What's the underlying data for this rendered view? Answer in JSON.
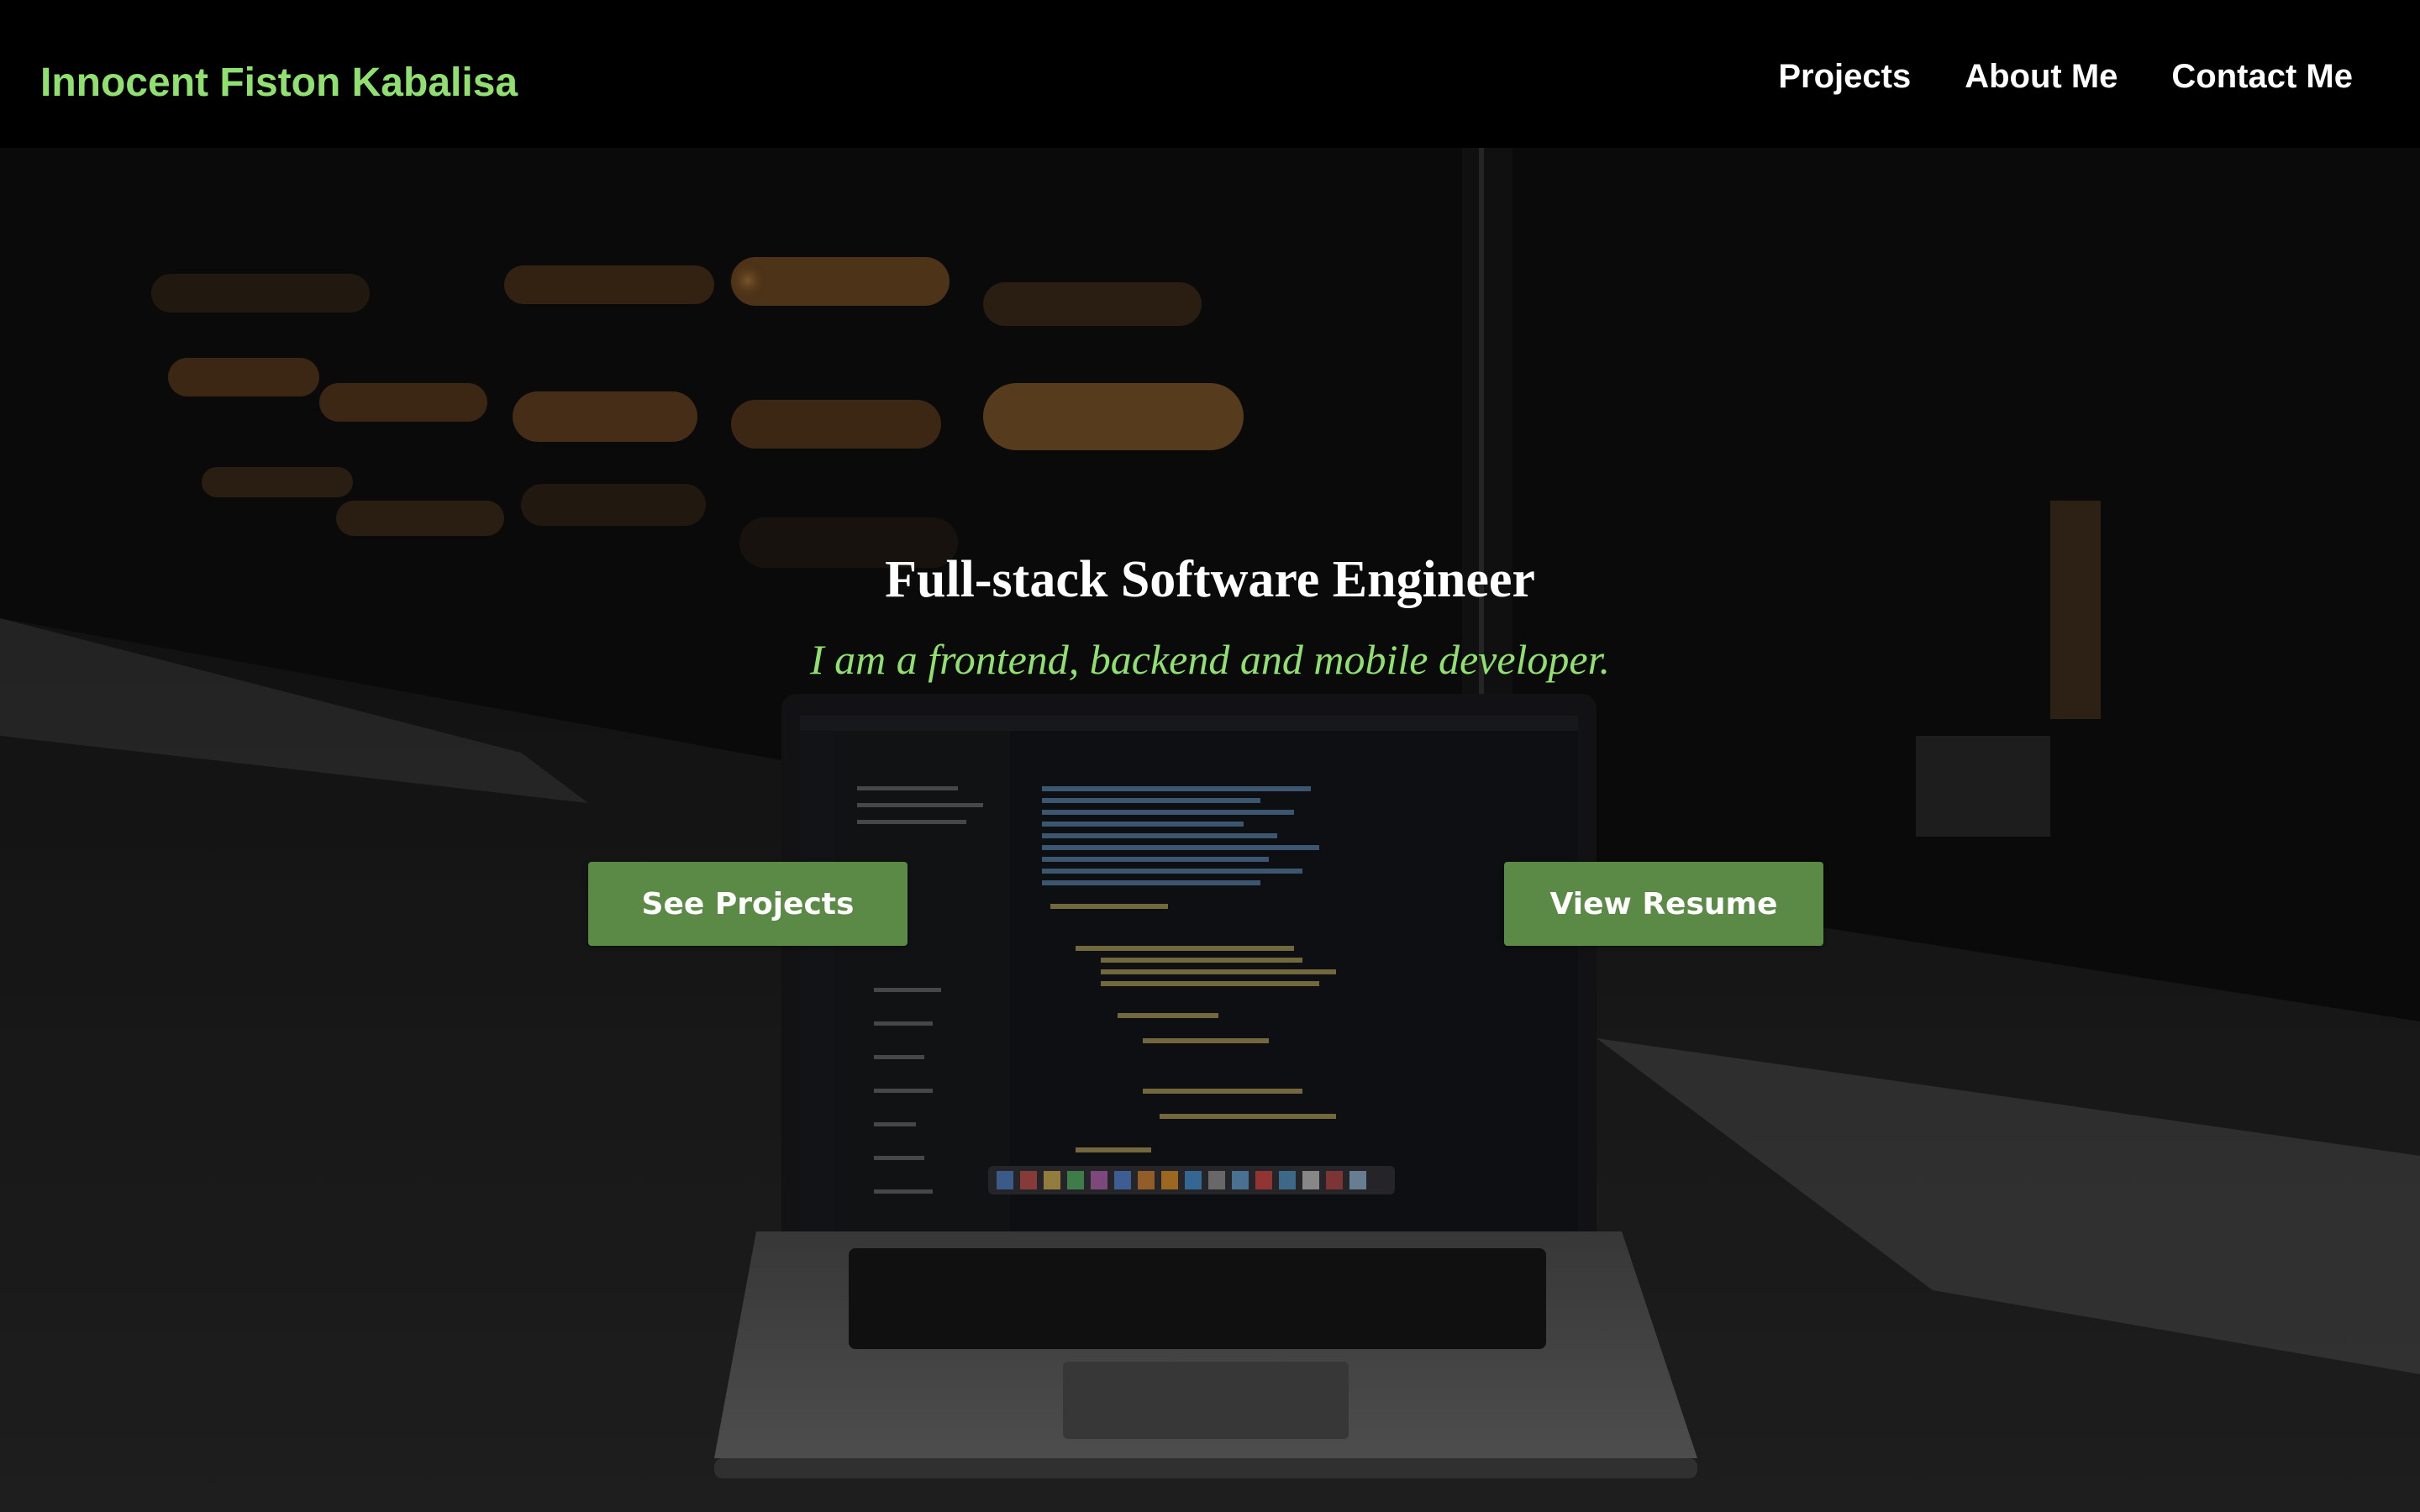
{
  "navbar": {
    "brand": "Innocent Fiston Kabalisa",
    "links": [
      {
        "label": "Projects"
      },
      {
        "label": "About Me"
      },
      {
        "label": "Contact Me"
      }
    ]
  },
  "hero": {
    "title": "Full-stack Software Engineer",
    "subtitle": "I am a frontend, backend and mobile developer.",
    "buttons": {
      "projects_label": "See Projects",
      "resume_label": "View Resume"
    },
    "background_image": "laptop-with-code-editor-dark-scene"
  },
  "colors": {
    "navbar_bg": "#000000",
    "brand": "#90e070",
    "subtitle": "#90e070",
    "button_bg": "#5a8a45",
    "text_light": "#ffffff"
  }
}
